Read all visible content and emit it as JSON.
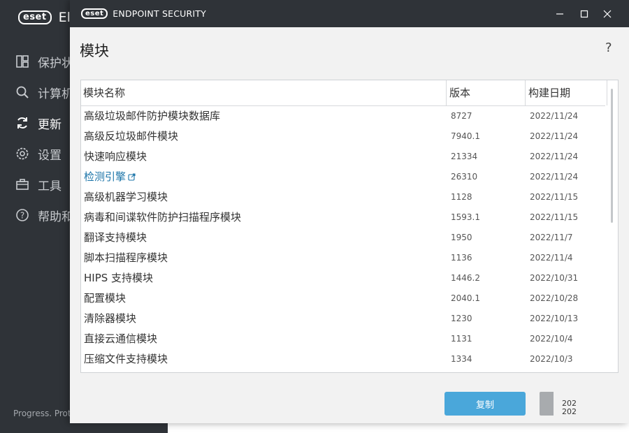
{
  "background_app": {
    "logo_text": "eset",
    "title_fragment": "El",
    "nav": [
      {
        "label": "保护状",
        "icon": "dashboard-icon"
      },
      {
        "label": "计算机",
        "icon": "search-icon"
      },
      {
        "label": "更新",
        "icon": "refresh-icon",
        "active": true
      },
      {
        "label": "设置",
        "icon": "gear-icon"
      },
      {
        "label": "工具",
        "icon": "toolbox-icon"
      },
      {
        "label": "帮助和",
        "icon": "help-icon"
      }
    ],
    "footer": "Progress. Prot"
  },
  "dialog": {
    "logo_text": "eset",
    "product_name": "ENDPOINT SECURITY",
    "heading": "模块",
    "help_label": "?",
    "table": {
      "columns": [
        "模块名称",
        "版本",
        "构建日期"
      ],
      "rows": [
        {
          "name": "高级垃圾邮件防护模块数据库",
          "version": "8727",
          "date": "2022/11/24"
        },
        {
          "name": "高级反垃圾邮件模块",
          "version": "7940.1",
          "date": "2022/11/24"
        },
        {
          "name": "快速响应模块",
          "version": "21334",
          "date": "2022/11/24"
        },
        {
          "name": "检测引擎",
          "version": "26310",
          "date": "2022/11/24",
          "link": true
        },
        {
          "name": "高级机器学习模块",
          "version": "1128",
          "date": "2022/11/15"
        },
        {
          "name": "病毒和间谍软件防护扫描程序模块",
          "version": "1593.1",
          "date": "2022/11/15"
        },
        {
          "name": "翻译支持模块",
          "version": "1950",
          "date": "2022/11/7"
        },
        {
          "name": "脚本扫描程序模块",
          "version": "1136",
          "date": "2022/11/4"
        },
        {
          "name": "HIPS 支持模块",
          "version": "1446.2",
          "date": "2022/10/31"
        },
        {
          "name": "配置模块",
          "version": "2040.1",
          "date": "2022/10/28"
        },
        {
          "name": "清除器模块",
          "version": "1230",
          "date": "2022/10/13"
        },
        {
          "name": "直接云通信模块",
          "version": "1131",
          "date": "2022/10/4"
        },
        {
          "name": "压缩文件支持模块",
          "version": "1334",
          "date": "2022/10/3"
        }
      ]
    },
    "copy_button": "复制",
    "overflow_text": [
      "202",
      "202"
    ]
  },
  "colors": {
    "dark": "#2f3338",
    "accent": "#4aa7da",
    "link": "#1b74a8"
  }
}
